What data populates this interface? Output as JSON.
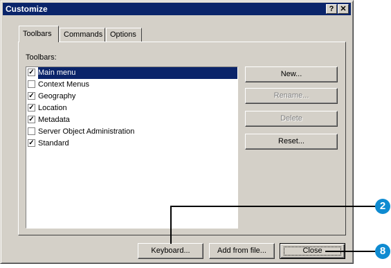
{
  "dialog": {
    "title": "Customize",
    "help_glyph": "?",
    "close_glyph": "✕"
  },
  "tabs": [
    {
      "label": "Toolbars"
    },
    {
      "label": "Commands"
    },
    {
      "label": "Options"
    }
  ],
  "toolbars_panel": {
    "list_label": "Toolbars:",
    "items": [
      {
        "label": "Main menu",
        "checked": true,
        "selected": true
      },
      {
        "label": "Context Menus",
        "checked": false,
        "selected": false
      },
      {
        "label": "Geography",
        "checked": true,
        "selected": false
      },
      {
        "label": "Location",
        "checked": true,
        "selected": false
      },
      {
        "label": "Metadata",
        "checked": true,
        "selected": false
      },
      {
        "label": "Server Object Administration",
        "checked": false,
        "selected": false
      },
      {
        "label": "Standard",
        "checked": true,
        "selected": false
      }
    ],
    "buttons": {
      "new": "New...",
      "rename": "Rename...",
      "delete": "Delete",
      "reset": "Reset..."
    }
  },
  "footer": {
    "keyboard": "Keyboard...",
    "add_from_file": "Add from file...",
    "close": "Close"
  },
  "callouts": [
    "2",
    "8"
  ],
  "colors": {
    "titlebar": "#0a246a",
    "face": "#d4d0c8",
    "callout": "#0f8bd1"
  }
}
